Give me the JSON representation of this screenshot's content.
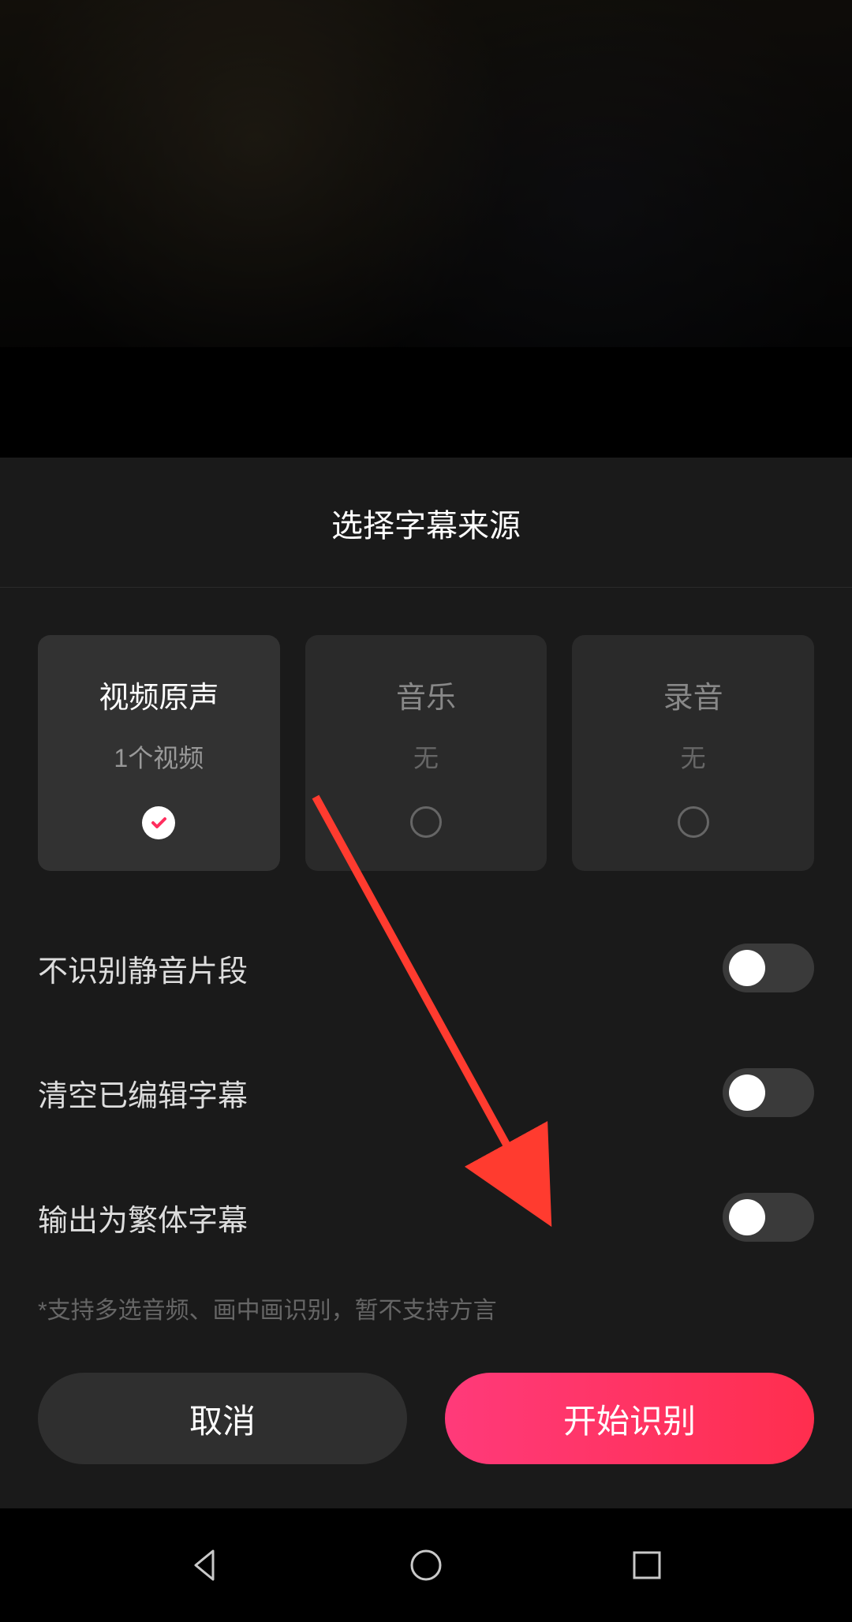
{
  "sheet": {
    "title": "选择字幕来源",
    "sources": [
      {
        "title": "视频原声",
        "sub": "1个视频",
        "selected": true
      },
      {
        "title": "音乐",
        "sub": "无",
        "selected": false
      },
      {
        "title": "录音",
        "sub": "无",
        "selected": false
      }
    ],
    "options": [
      {
        "label": "不识别静音片段",
        "on": false
      },
      {
        "label": "清空已编辑字幕",
        "on": false
      },
      {
        "label": "输出为繁体字幕",
        "on": false
      }
    ],
    "hint": "*支持多选音频、画中画识别，暂不支持方言",
    "buttons": {
      "cancel": "取消",
      "primary": "开始识别"
    }
  }
}
